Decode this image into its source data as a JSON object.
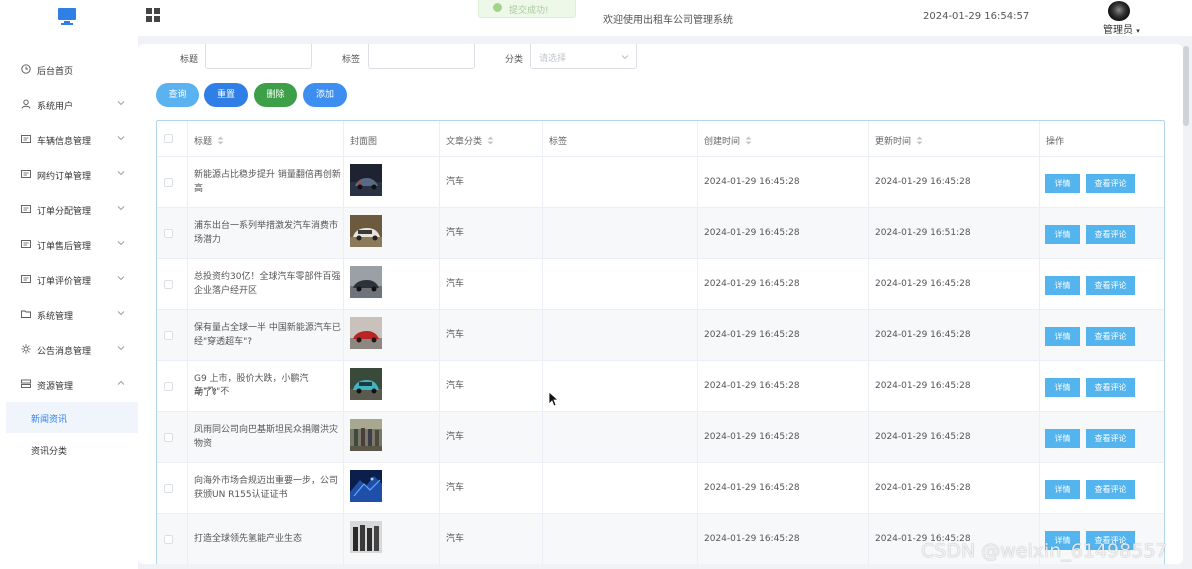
{
  "header": {
    "title": "欢迎使用出租车公司管理系统",
    "datetime": "2024-01-29 16:54:57",
    "user": "管理员",
    "toast": "提交成功!"
  },
  "sidebar": {
    "items": [
      {
        "label": "后台首页",
        "icon": "clock-icon"
      },
      {
        "label": "系统用户",
        "icon": "user-icon"
      },
      {
        "label": "车辆信息管理",
        "icon": "doc-icon"
      },
      {
        "label": "网约订单管理",
        "icon": "doc-icon"
      },
      {
        "label": "订单分配管理",
        "icon": "doc-icon"
      },
      {
        "label": "订单售后管理",
        "icon": "doc-icon"
      },
      {
        "label": "订单评价管理",
        "icon": "doc-icon"
      },
      {
        "label": "系统管理",
        "icon": "folder-icon"
      },
      {
        "label": "公告消息管理",
        "icon": "sun-icon"
      },
      {
        "label": "资源管理",
        "icon": "stack-icon"
      }
    ],
    "sub_items": [
      {
        "label": "新闻资讯",
        "active": true
      },
      {
        "label": "资讯分类",
        "active": false
      }
    ]
  },
  "filters": {
    "title_label": "标题",
    "tag_label": "标签",
    "category_label": "分类",
    "category_placeholder": "请选择"
  },
  "buttons": {
    "search": "查询",
    "reset": "重置",
    "delete": "删除",
    "add": "添加"
  },
  "table": {
    "columns": [
      "标题",
      "封面图",
      "文章分类",
      "标签",
      "创建时间",
      "更新时间",
      "操作"
    ],
    "detail_label": "详情",
    "comments_label": "查看评论",
    "rows": [
      {
        "title_line1": "新能源占比稳步提升 销量翻倍再创新",
        "title_line2": "高",
        "category": "汽车",
        "tag": "",
        "created": "2024-01-29 16:45:28",
        "updated": "2024-01-29 16:45:28"
      },
      {
        "title_line1": "浦东出台一系列举措激发汽车消费市",
        "title_line2": "场潜力",
        "category": "汽车",
        "tag": "",
        "created": "2024-01-29 16:45:28",
        "updated": "2024-01-29 16:51:28"
      },
      {
        "title_line1": "总投资约30亿！全球汽车零部件百强",
        "title_line2": "企业落户经开区",
        "category": "汽车",
        "tag": "",
        "created": "2024-01-29 16:45:28",
        "updated": "2024-01-29 16:45:28"
      },
      {
        "title_line1": "保有量占全球一半 中国新能源汽车已",
        "title_line2": "经\"穿透超车\"?",
        "category": "汽车",
        "tag": "",
        "created": "2024-01-29 16:45:28",
        "updated": "2024-01-29 16:45:28"
      },
      {
        "title_line1": "G9 上市，股价大跌，小鹏汽车\"飞\"不",
        "title_line2": "动了?",
        "category": "汽车",
        "tag": "",
        "created": "2024-01-29 16:45:28",
        "updated": "2024-01-29 16:45:28"
      },
      {
        "title_line1": "凤雨同公司向巴基斯坦民众捐赠洪灾",
        "title_line2": "物资",
        "category": "汽车",
        "tag": "",
        "created": "2024-01-29 16:45:28",
        "updated": "2024-01-29 16:45:28"
      },
      {
        "title_line1": "向海外市场合规迈出重要一步，公司",
        "title_line2": "获颁UN R155认证证书",
        "category": "汽车",
        "tag": "",
        "created": "2024-01-29 16:45:28",
        "updated": "2024-01-29 16:45:28"
      },
      {
        "title_line1": "打造全球领先氢能产业生态",
        "title_line2": "",
        "category": "汽车",
        "tag": "",
        "created": "2024-01-29 16:45:28",
        "updated": "2024-01-29 16:45:28"
      }
    ]
  },
  "watermark": "CSDN @weixin_61498557",
  "colors": {
    "search_btn": "#5ab2f0",
    "reset_btn": "#2f7fe6",
    "delete_btn": "#3d9f48",
    "add_btn": "#3c8ff0",
    "action_btn": "#54b4ee"
  }
}
